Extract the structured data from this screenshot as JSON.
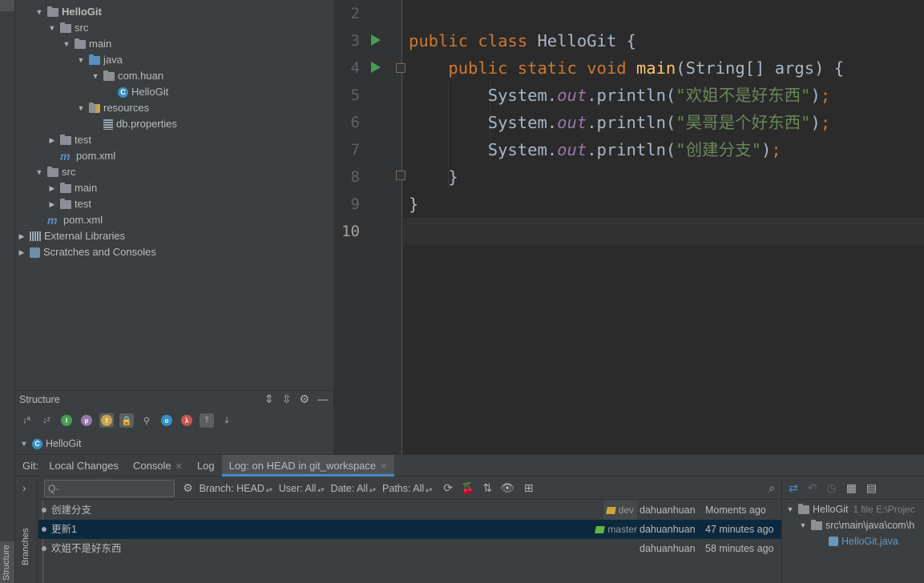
{
  "left_strip": {
    "label": "Structure"
  },
  "project_tree": [
    {
      "label": "HelloGit",
      "icon": "module-folder-icon",
      "arrow": "▼",
      "bold": true
    },
    {
      "label": "src",
      "icon": "folder-icon",
      "arrow": "▼"
    },
    {
      "label": "main",
      "icon": "folder-icon",
      "arrow": "▼"
    },
    {
      "label": "java",
      "icon": "source-folder-icon",
      "arrow": "▼"
    },
    {
      "label": "com.huan",
      "icon": "package-icon",
      "arrow": "▼"
    },
    {
      "label": "HelloGit",
      "icon": "java-class-icon",
      "arrow": ""
    },
    {
      "label": "resources",
      "icon": "resources-folder-icon",
      "arrow": "▼"
    },
    {
      "label": "db.properties",
      "icon": "properties-file-icon",
      "arrow": ""
    },
    {
      "label": "test",
      "icon": "folder-icon",
      "arrow": "▶"
    },
    {
      "label": "pom.xml",
      "icon": "maven-icon",
      "arrow": ""
    },
    {
      "label": "src",
      "icon": "folder-icon",
      "arrow": "▼"
    },
    {
      "label": "main",
      "icon": "folder-icon",
      "arrow": "▶"
    },
    {
      "label": "test",
      "icon": "folder-icon",
      "arrow": "▶"
    },
    {
      "label": "pom.xml",
      "icon": "maven-icon",
      "arrow": ""
    },
    {
      "label": "External Libraries",
      "icon": "libraries-icon",
      "arrow": "▶"
    },
    {
      "label": "Scratches and Consoles",
      "icon": "scratches-icon",
      "arrow": "▶"
    }
  ],
  "structure": {
    "title": "Structure",
    "node_label": "HelloGit"
  },
  "editor": {
    "line_numbers": [
      "2",
      "3",
      "4",
      "5",
      "6",
      "7",
      "8",
      "9",
      "10"
    ],
    "lines": {
      "l3": {
        "kw1": "public",
        "kw2": "class",
        "name": " HelloGit {"
      },
      "l4": {
        "kw1": "public",
        "kw2": "static",
        "kw3": "void",
        "fn": "main",
        "rest": "(String[] args) {"
      },
      "l5": {
        "obj": "System.",
        "fld": "out",
        "call": ".println(",
        "str": "\"欢姐不是好东西\"",
        "end": ")",
        "semi": ";"
      },
      "l6": {
        "obj": "System.",
        "fld": "out",
        "call": ".println(",
        "str": "\"昊哥是个好东西\"",
        "end": ")",
        "semi": ";"
      },
      "l7": {
        "obj": "System.",
        "fld": "out",
        "call": ".println(",
        "str": "\"创建分支\"",
        "end": ")",
        "semi": ";"
      },
      "l8": {
        "text": "}"
      },
      "l9": {
        "text": "}"
      }
    }
  },
  "git": {
    "tabs": {
      "git_label": "Git:",
      "local_changes": "Local Changes",
      "console": "Console",
      "log": "Log",
      "log_head": "Log: on HEAD in git_workspace"
    },
    "side_label": "Branches",
    "filters": {
      "branch": "Branch: HEAD",
      "user": "User: All",
      "date": "Date: All",
      "paths": "Paths: All"
    },
    "search_placeholder": "Q-",
    "commits": [
      {
        "message": "创建分支",
        "ref": "dev",
        "author": "dahuanhuan",
        "date": "Moments ago",
        "selected": false
      },
      {
        "message": "更新1",
        "ref": "master",
        "author": "dahuanhuan",
        "date": "47 minutes ago",
        "selected": true
      },
      {
        "message": "欢姐不是好东西",
        "ref": "",
        "author": "dahuanhuan",
        "date": "58 minutes ago",
        "selected": false
      }
    ],
    "changes": {
      "root_label": "HelloGit",
      "root_meta": "1 file  E:\\Projec",
      "dir_label": "src\\main\\java\\com\\h",
      "file_label": "HelloGit.java"
    }
  },
  "colors": {
    "keyword": "#cc7832",
    "function": "#ffc66d",
    "field": "#9876aa",
    "string": "#6a8759",
    "selection": "#0d293e",
    "accent": "#4a88c7"
  }
}
